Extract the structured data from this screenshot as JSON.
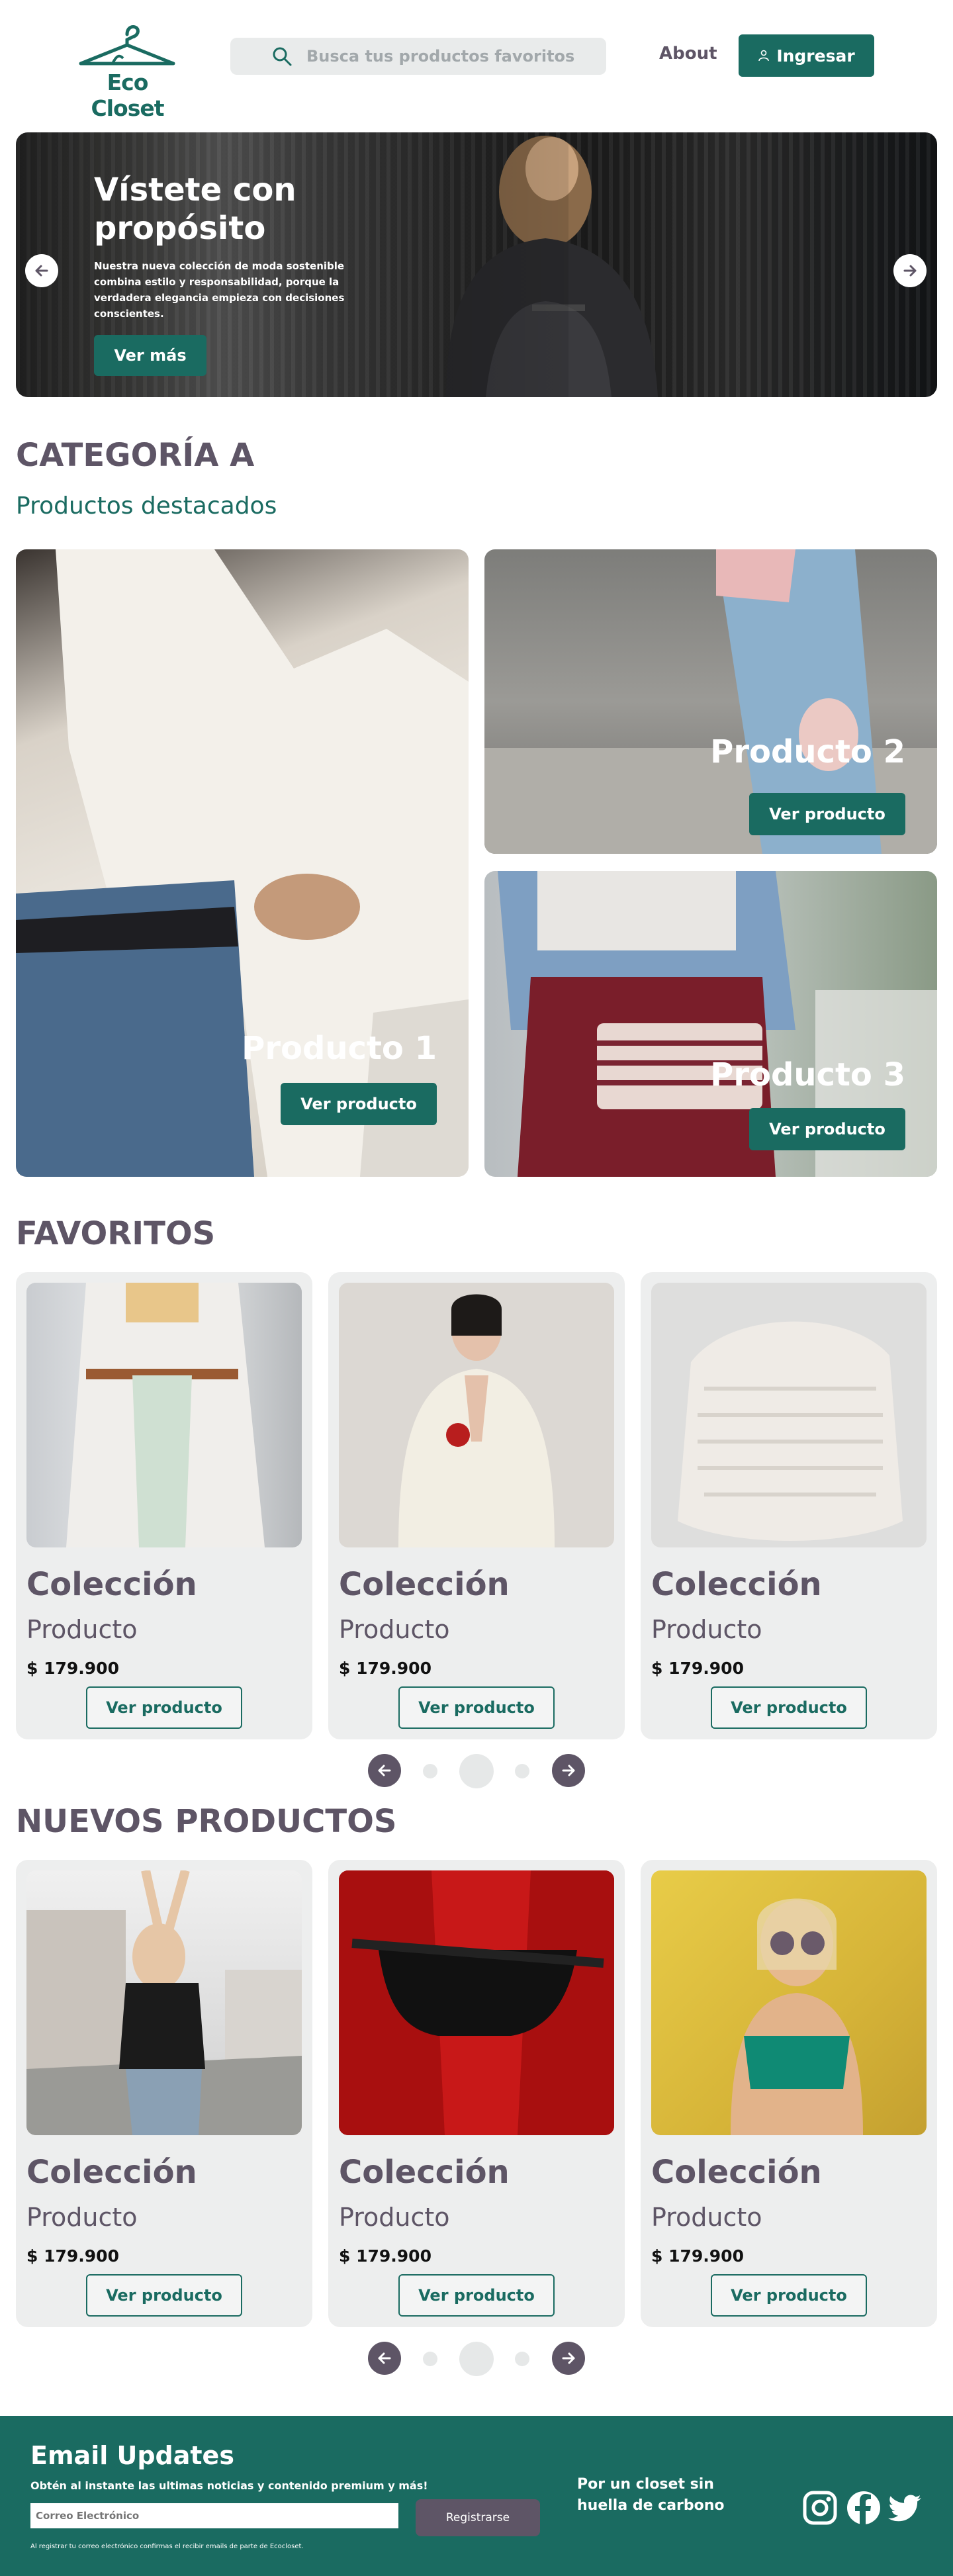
{
  "header": {
    "logo_text": "Eco Closet",
    "search_placeholder": "Busca tus productos favoritos",
    "about": "About",
    "login": "Ingresar"
  },
  "hero": {
    "title": "Vístete con propósito",
    "description": "Nuestra nueva colección de moda sostenible combina estilo y responsabilidad, porque la verdadera elegancia empieza con decisiones conscientes.",
    "cta": "Ver más"
  },
  "category": {
    "title": "CATEGORÍA A",
    "subtitle": "Productos destacados",
    "items": [
      {
        "name": "Producto 1",
        "cta": "Ver producto"
      },
      {
        "name": "Producto 2",
        "cta": "Ver producto"
      },
      {
        "name": "Producto 3",
        "cta": "Ver producto"
      }
    ]
  },
  "favorites": {
    "title": "FAVORITOS",
    "cards": [
      {
        "collection": "Colección",
        "product": "Producto",
        "price": "$ 179.900",
        "cta": "Ver producto"
      },
      {
        "collection": "Colección",
        "product": "Producto",
        "price": "$ 179.900",
        "cta": "Ver producto"
      },
      {
        "collection": "Colección",
        "product": "Producto",
        "price": "$ 179.900",
        "cta": "Ver producto"
      }
    ]
  },
  "new_products": {
    "title": "NUEVOS PRODUCTOS",
    "cards": [
      {
        "collection": "Colección",
        "product": "Producto",
        "price": "$ 179.900",
        "cta": "Ver producto"
      },
      {
        "collection": "Colección",
        "product": "Producto",
        "price": "$ 179.900",
        "cta": "Ver producto"
      },
      {
        "collection": "Colección",
        "product": "Producto",
        "price": "$ 179.900",
        "cta": "Ver producto"
      }
    ]
  },
  "footer": {
    "title": "Email Updates",
    "subtitle": "Obtén al instante las ultimas noticias y contenido premium y más!",
    "email_placeholder": "Correo Electrónico",
    "submit": "Registrarse",
    "note": "Al registrar tu correo electrónico confirmas el recibir emails de parte de Ecocloset.",
    "tagline": "Por un closet sin huella de carbono",
    "social": [
      "instagram-icon",
      "facebook-icon",
      "twitter-icon"
    ]
  },
  "colors": {
    "brand": "#1a6b61",
    "text": "#5e5566",
    "card_bg": "#edeeee"
  }
}
